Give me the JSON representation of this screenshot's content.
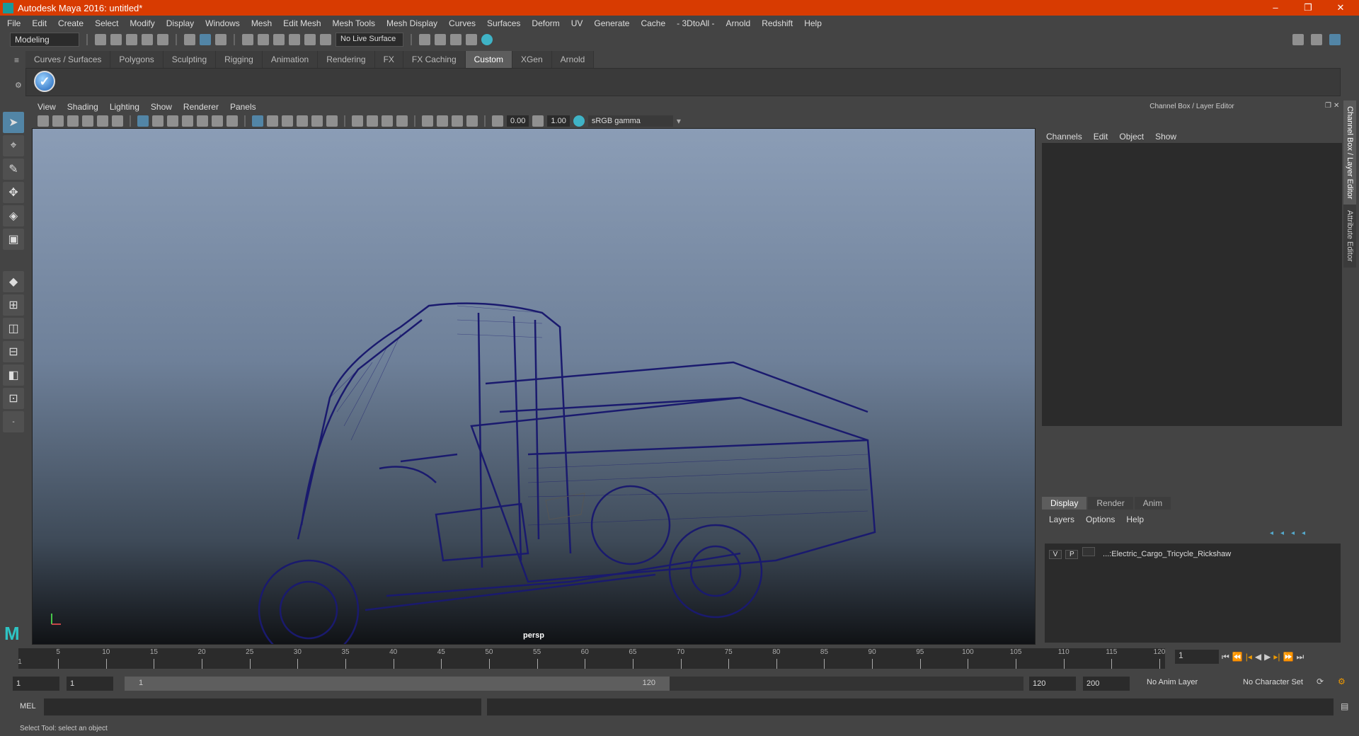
{
  "window": {
    "title": "Autodesk Maya 2016: untitled*",
    "minimize": "–",
    "restore": "❐",
    "close": "✕"
  },
  "menubar": [
    "File",
    "Edit",
    "Create",
    "Select",
    "Modify",
    "Display",
    "Windows",
    "Mesh",
    "Edit Mesh",
    "Mesh Tools",
    "Mesh Display",
    "Curves",
    "Surfaces",
    "Deform",
    "UV",
    "Generate",
    "Cache",
    "- 3DtoAll -",
    "Arnold",
    "Redshift",
    "Help"
  ],
  "toolbar": {
    "mode": "Modeling",
    "live_surface": "No Live Surface"
  },
  "shelf": {
    "tabs": [
      "Curves / Surfaces",
      "Polygons",
      "Sculpting",
      "Rigging",
      "Animation",
      "Rendering",
      "FX",
      "FX Caching",
      "Custom",
      "XGen",
      "Arnold"
    ],
    "active": "Custom"
  },
  "viewport": {
    "menu": [
      "View",
      "Shading",
      "Lighting",
      "Show",
      "Renderer",
      "Panels"
    ],
    "exposure": "0.00",
    "gamma": "1.00",
    "color_space": "sRGB gamma",
    "camera": "persp",
    "wire_color": "#1a1a6e"
  },
  "channel_box": {
    "title": "Channel Box / Layer Editor",
    "menu": [
      "Channels",
      "Edit",
      "Object",
      "Show"
    ],
    "layer_tabs": [
      "Display",
      "Render",
      "Anim"
    ],
    "active_layer_tab": "Display",
    "layer_menu": [
      "Layers",
      "Options",
      "Help"
    ],
    "layers": [
      {
        "v": "V",
        "p": "P",
        "name": "...:Electric_Cargo_Tricycle_Rickshaw"
      }
    ]
  },
  "side_tabs": [
    "Channel Box / Layer Editor",
    "Attribute Editor"
  ],
  "timeline": {
    "start": 1,
    "end": 120,
    "ticks": [
      5,
      10,
      15,
      20,
      25,
      30,
      35,
      40,
      45,
      50,
      55,
      60,
      65,
      70,
      75,
      80,
      85,
      90,
      95,
      100,
      105,
      110,
      115,
      120
    ],
    "current_frame": "1",
    "current_label": "1"
  },
  "range": {
    "start": "1",
    "playback_start": "1",
    "slider_start": "1",
    "slider_end": "120",
    "playback_end": "120",
    "end": "200",
    "anim_layer": "No Anim Layer",
    "character_set": "No Character Set"
  },
  "command": {
    "lang": "MEL"
  },
  "status": "Select Tool: select an object"
}
